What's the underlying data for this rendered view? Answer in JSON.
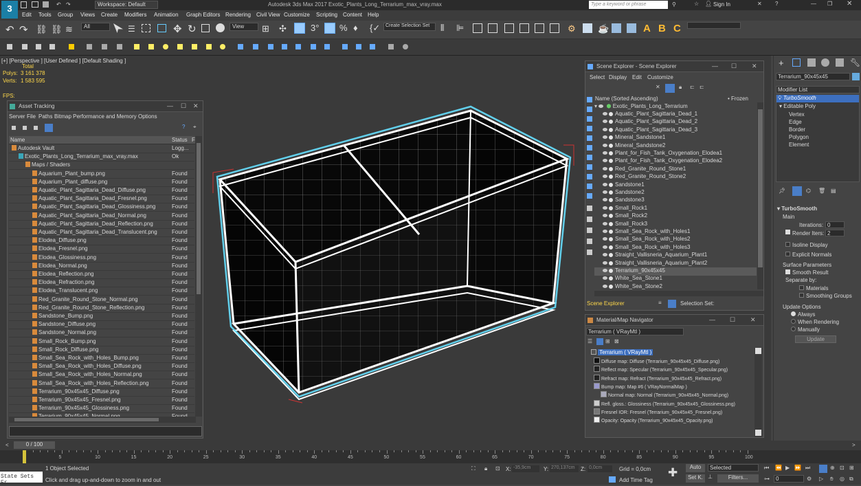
{
  "window": {
    "workspace": "Workspace: Default",
    "title": "Autodesk 3ds Max 2017    Exotic_Plants_Long_Terrarium_max_vray.max",
    "search_placeholder": "Type a keyword or phrase",
    "sign_in": "Sign In"
  },
  "menu": [
    "Edit",
    "Tools",
    "Group",
    "Views",
    "Create",
    "Modifiers",
    "Animation",
    "Graph Editors",
    "Rendering",
    "Civil View",
    "Customize",
    "Scripting",
    "Content",
    "Help"
  ],
  "toolbar": {
    "filter": "All",
    "view": "View",
    "selection_set": "Create Selection Set"
  },
  "viewport": {
    "label": "[+] [Perspective ] [User Defined ] [Default Shading ]",
    "stats_header": "Total",
    "polys_label": "Polys:",
    "polys": "3 161 378",
    "verts_label": "Verts:",
    "verts": "1 583 595",
    "fps": "FPS:"
  },
  "asset_tracking": {
    "title": "Asset Tracking",
    "menu": [
      "Server",
      "File",
      "Paths",
      "Bitmap Performance and Memory",
      "Options"
    ],
    "col_name": "Name",
    "col_status": "Status",
    "col_extra": "F",
    "rows": [
      {
        "name": "Autodesk Vault",
        "status": "Logg...",
        "indent": 0
      },
      {
        "name": "Exotic_Plants_Long_Terrarium_max_vray.max",
        "status": "Ok",
        "indent": 1
      },
      {
        "name": "Maps / Shaders",
        "status": "",
        "indent": 2
      },
      {
        "name": "Aquarium_Plant_bump.png",
        "status": "Found",
        "indent": 3
      },
      {
        "name": "Aquarium_Plant_diffuse.png",
        "status": "Found",
        "indent": 3
      },
      {
        "name": "Aquatic_Plant_Sagittaria_Dead_Diffuse.png",
        "status": "Found",
        "indent": 3
      },
      {
        "name": "Aquatic_Plant_Sagittaria_Dead_Fresnel.png",
        "status": "Found",
        "indent": 3
      },
      {
        "name": "Aquatic_Plant_Sagittaria_Dead_Glossiness.png",
        "status": "Found",
        "indent": 3
      },
      {
        "name": "Aquatic_Plant_Sagittaria_Dead_Normal.png",
        "status": "Found",
        "indent": 3
      },
      {
        "name": "Aquatic_Plant_Sagittaria_Dead_Reflection.png",
        "status": "Found",
        "indent": 3
      },
      {
        "name": "Aquatic_Plant_Sagittaria_Dead_Translucent.png",
        "status": "Found",
        "indent": 3
      },
      {
        "name": "Elodea_Diffuse.png",
        "status": "Found",
        "indent": 3
      },
      {
        "name": "Elodea_Fresnel.png",
        "status": "Found",
        "indent": 3
      },
      {
        "name": "Elodea_Glossiness.png",
        "status": "Found",
        "indent": 3
      },
      {
        "name": "Elodea_Normal.png",
        "status": "Found",
        "indent": 3
      },
      {
        "name": "Elodea_Reflection.png",
        "status": "Found",
        "indent": 3
      },
      {
        "name": "Elodea_Refraction.png",
        "status": "Found",
        "indent": 3
      },
      {
        "name": "Elodea_Translucent.png",
        "status": "Found",
        "indent": 3
      },
      {
        "name": "Red_Granite_Round_Stone_Normal.png",
        "status": "Found",
        "indent": 3
      },
      {
        "name": "Red_Granite_Round_Stone_Reflection.png",
        "status": "Found",
        "indent": 3
      },
      {
        "name": "Sandstone_Bump.png",
        "status": "Found",
        "indent": 3
      },
      {
        "name": "Sandstone_Diffuse.png",
        "status": "Found",
        "indent": 3
      },
      {
        "name": "Sandstone_Normal.png",
        "status": "Found",
        "indent": 3
      },
      {
        "name": "Small_Rock_Bump.png",
        "status": "Found",
        "indent": 3
      },
      {
        "name": "Small_Rock_Diffuse.png",
        "status": "Found",
        "indent": 3
      },
      {
        "name": "Small_Sea_Rock_with_Holes_Bump.png",
        "status": "Found",
        "indent": 3
      },
      {
        "name": "Small_Sea_Rock_with_Holes_Diffuse.png",
        "status": "Found",
        "indent": 3
      },
      {
        "name": "Small_Sea_Rock_with_Holes_Normal.png",
        "status": "Found",
        "indent": 3
      },
      {
        "name": "Small_Sea_Rock_with_Holes_Reflection.png",
        "status": "Found",
        "indent": 3
      },
      {
        "name": "Terrarium_90x45x45_Diffuse.png",
        "status": "Found",
        "indent": 3
      },
      {
        "name": "Terrarium_90x45x45_Fresnel.png",
        "status": "Found",
        "indent": 3
      },
      {
        "name": "Terrarium_90x45x45_Glossiness.png",
        "status": "Found",
        "indent": 3
      },
      {
        "name": "Terrarium_90x45x45_Normal.png",
        "status": "Found",
        "indent": 3
      }
    ]
  },
  "scene_explorer": {
    "title": "Scene Explorer - Scene Explorer",
    "menu": [
      "Select",
      "Display",
      "Edit",
      "Customize"
    ],
    "col_name": "Name (Sorted Ascending)",
    "col_frozen": "• Frozen",
    "root": "Exotic_Plants_Long_Terrarium",
    "items": [
      "Aquatic_Plant_Sagittaria_Dead_1",
      "Aquatic_Plant_Sagittaria_Dead_2",
      "Aquatic_Plant_Sagittaria_Dead_3",
      "Mineral_Sandstone1",
      "Mineral_Sandstone2",
      "Plant_for_Fish_Tank_Oxygenation_Elodea1",
      "Plant_for_Fish_Tank_Oxygenation_Elodea2",
      "Red_Granite_Round_Stone1",
      "Red_Granite_Round_Stone2",
      "Sandstone1",
      "Sandstone2",
      "Sandstone3",
      "Small_Rock1",
      "Small_Rock2",
      "Small_Rock3",
      "Small_Sea_Rock_with_Holes1",
      "Small_Sea_Rock_with_Holes2",
      "Small_Sea_Rock_with_Holes3",
      "Straight_Vallisneria_Aquarium_Plant1",
      "Straight_Vallisneria_Aquarium_Plant2",
      "Terrarium_90x45x45",
      "White_Sea_Stone1",
      "White_Sea_Stone2"
    ],
    "selected": "Terrarium_90x45x45",
    "footer_label": "Scene Explorer",
    "selection_set": "Selection Set:"
  },
  "material_nav": {
    "title": "Material/Map Navigator",
    "field": "Terrarium  ( VRayMtl )",
    "root": "Terrarium  ( VRayMtl )",
    "items": [
      "Diffuse map: Diffuse (Terrarium_90x45x45_Diffuse.png)",
      "Reflect map: Specular (Terrarium_90x45x45_Specular.png)",
      "Refract map: Refract (Terrarium_90x45x45_Refract.png)",
      "Bump map: Map #6  ( VRayNormalMap )",
      "Normal map: Normal (Terrarium_90x45x45_Normal.png)",
      "Refl. gloss.: Glossiness (Terrarium_90x45x45_Glossiness.png)",
      "Fresnel IOR: Fresnel (Terrarium_90x45x45_Fresnel.png)",
      "Opacity: Opacity (Terrarium_90x45x45_Opacity.png)"
    ]
  },
  "command_panel": {
    "object_name": "Terrarium_90x45x45",
    "modifier_list": "Modifier List",
    "stack": [
      "TurboSmooth",
      "Editable Poly",
      "Vertex",
      "Edge",
      "Border",
      "Polygon",
      "Element"
    ],
    "rollout": "TurboSmooth",
    "main": "Main",
    "iterations_label": "Iterations:",
    "iterations": "0",
    "render_iters_label": "Render Iters:",
    "render_iters": "2",
    "isoline": "Isoline Display",
    "explicit": "Explicit Normals",
    "surface": "Surface Parameters",
    "smooth": "Smooth Result",
    "separate": "Separate by:",
    "materials": "Materials",
    "smoothing": "Smoothing Groups",
    "update_options": "Update Options",
    "always": "Always",
    "when_rendering": "When Rendering",
    "manually": "Manually",
    "update_btn": "Update"
  },
  "timeline": {
    "frame": "0 / 100",
    "ticks": [
      "0",
      "5",
      "10",
      "15",
      "20",
      "25",
      "30",
      "35",
      "40",
      "45",
      "50",
      "55",
      "60",
      "65",
      "70",
      "75",
      "80",
      "85",
      "90",
      "95",
      "100"
    ]
  },
  "status": {
    "script": "State Sets Er",
    "selected": "1 Object Selected",
    "hint": "Click and drag up-and-down to zoom in and out",
    "x_label": "X:",
    "x": "-35,9cm",
    "y_label": "Y:",
    "y": "270,137cm",
    "z_label": "Z:",
    "z": "0,0cm",
    "grid": "Grid = 0,0cm",
    "add_time_tag": "Add Time Tag",
    "auto": "Auto",
    "set_k": "Set K.",
    "selected_dd": "Selected",
    "filters": "Filters...",
    "frame_field": "0"
  },
  "colors": {
    "selection": "#3da8ff",
    "bg": "#444444",
    "wire": "#ffffff",
    "cyan": "#66e0ff"
  }
}
